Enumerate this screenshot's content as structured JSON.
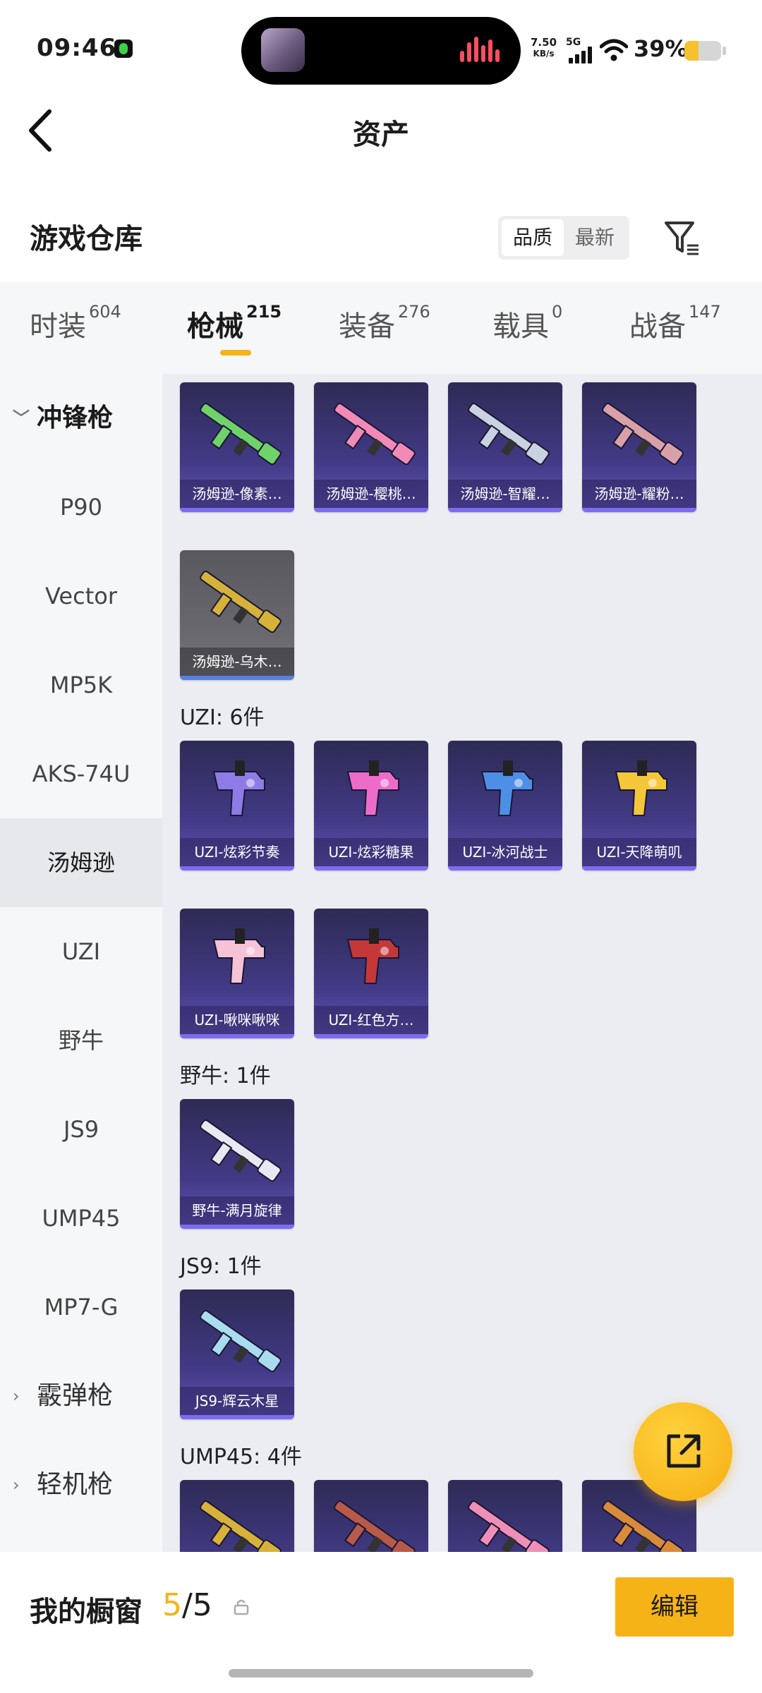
{
  "status_bar": {
    "time": "09:46",
    "net_speed_value": "7.50",
    "net_speed_unit": "KB/s",
    "network": "5G",
    "battery_pct": "39%",
    "battery_level": 0.39
  },
  "header": {
    "title": "资产"
  },
  "section": {
    "title": "游戏仓库",
    "sort_options": [
      "品质",
      "最新"
    ],
    "sort_active": "品质"
  },
  "tabs": [
    {
      "label": "时装",
      "count": "604"
    },
    {
      "label": "枪械",
      "count": "215"
    },
    {
      "label": "装备",
      "count": "276"
    },
    {
      "label": "载具",
      "count": "0"
    },
    {
      "label": "战备",
      "count": "147"
    }
  ],
  "active_tab": "枪械",
  "sidebar": [
    {
      "label": "冲锋枪",
      "type": "group-open"
    },
    {
      "label": "P90"
    },
    {
      "label": "Vector"
    },
    {
      "label": "MP5K"
    },
    {
      "label": "AKS-74U"
    },
    {
      "label": "汤姆逊",
      "selected": true
    },
    {
      "label": "UZI"
    },
    {
      "label": "野牛"
    },
    {
      "label": "JS9"
    },
    {
      "label": "UMP45"
    },
    {
      "label": "MP7-G"
    },
    {
      "label": "霰弹枪",
      "type": "group-closed"
    },
    {
      "label": "轻机枪",
      "type": "group-closed"
    }
  ],
  "grid": {
    "thompson_items": [
      {
        "name": "汤姆逊-像素…",
        "color": "#6fd36a"
      },
      {
        "name": "汤姆逊-樱桃…",
        "color": "#f08bb8"
      },
      {
        "name": "汤姆逊-智耀…",
        "color": "#c9d2e0"
      },
      {
        "name": "汤姆逊-耀粉…",
        "color": "#d9a0a8"
      },
      {
        "name": "汤姆逊-乌木…",
        "color": "#d6b23a",
        "gray": true
      }
    ],
    "uzi_header": "UZI: 6件",
    "uzi_items": [
      {
        "name": "UZI-炫彩节奏",
        "color": "#8f7be6"
      },
      {
        "name": "UZI-炫彩糖果",
        "color": "#ee6cc9"
      },
      {
        "name": "UZI-冰河战士",
        "color": "#4d8fe6"
      },
      {
        "name": "UZI-天降萌叽",
        "color": "#f4c63a"
      },
      {
        "name": "UZI-啾咪啾咪",
        "color": "#f6c3d6"
      },
      {
        "name": "UZI-红色方…",
        "color": "#c43838"
      }
    ],
    "bison_header": "野牛: 1件",
    "bison_items": [
      {
        "name": "野牛-满月旋律",
        "color": "#e8e8f2"
      }
    ],
    "js9_header": "JS9: 1件",
    "js9_items": [
      {
        "name": "JS9-辉云木星",
        "color": "#a9dcef"
      }
    ],
    "ump_header": "UMP45: 4件",
    "ump_items": [
      {
        "name": "",
        "color": "#d6b23a"
      },
      {
        "name": "",
        "color": "#b85a4a"
      },
      {
        "name": "",
        "color": "#ef8fb8"
      },
      {
        "name": "",
        "color": "#d98a3a"
      }
    ]
  },
  "bottom_bar": {
    "label": "我的橱窗",
    "count_current": "5",
    "count_total": "/5",
    "edit_label": "编辑"
  }
}
